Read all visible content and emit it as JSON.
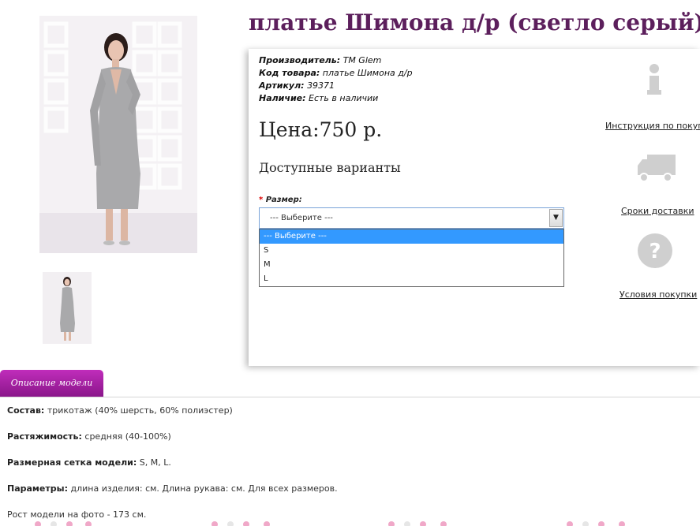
{
  "product": {
    "title": "платье Шимона д/р (светло серый)"
  },
  "meta": {
    "manufacturer_label": "Производитель:",
    "manufacturer_value": "TM Glem",
    "code_label": "Код товара:",
    "code_value": "платье Шимона д/р",
    "sku_label": "Артикул:",
    "sku_value": "39371",
    "stock_label": "Наличие:",
    "stock_value": "Есть в наличии"
  },
  "price": "Цена:750 р.",
  "variants_heading": "Доступные варианты",
  "size": {
    "required_mark": "*",
    "label": "Размер:",
    "selected": "--- Выберите ---",
    "options": [
      "--- Выберите ---",
      "S",
      "M",
      "L"
    ]
  },
  "side_links": {
    "instructions": "Инструкция по покупк",
    "delivery": "Сроки доставки",
    "terms": "Условия покупки"
  },
  "tab": {
    "label": "Описание модели"
  },
  "description": {
    "composition_label": "Состав:",
    "composition_value": "трикотаж (40% шерсть, 60% полиэстер)",
    "stretch_label": "Растяжимость:",
    "stretch_value": "средняя (40-100%)",
    "sizes_label": "Размерная сетка модели:",
    "sizes_value": "S, M, L.",
    "params_label": "Параметры:",
    "params_value": "длина изделия: см. Длина рукава: см. Для всех размеров.",
    "height_text": "Рост модели на фото - 173 см."
  },
  "colors": {
    "title": "#5c1f5c",
    "tab_top": "#c02dbb",
    "tab_bottom": "#8a168a",
    "dropdown_selected": "#3399ff",
    "icon_gray": "#cfcfcf"
  }
}
